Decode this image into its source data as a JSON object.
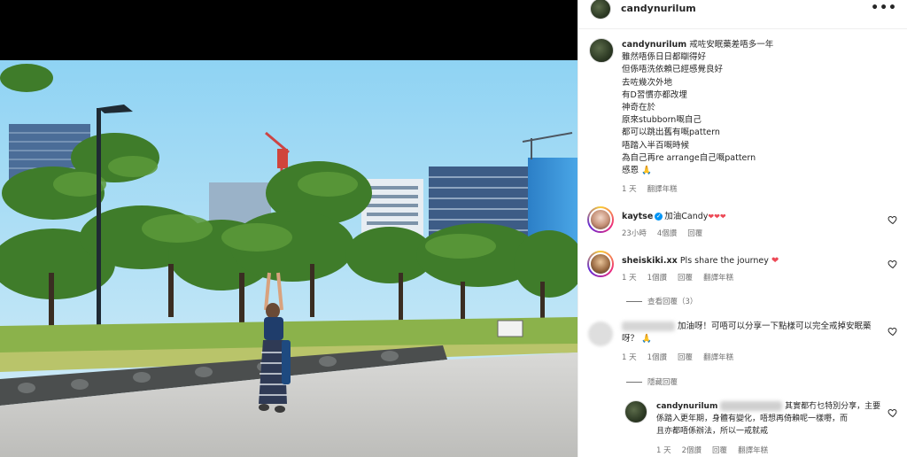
{
  "post": {
    "username": "candynurilum",
    "more_icon": "more-horizontal-icon",
    "caption_lines": [
      "戒咗安眠藥差唔多一年",
      "雖然唔係日日都瞓得好",
      "但係唔洗依賴已經感覺良好",
      "去咗幾次外地",
      "有D習慣亦都改埋",
      "神奇在於",
      "原來stubborn嘅自己",
      "都可以跳出舊有嘅pattern",
      "唔踏入半百嘅時候",
      "為自己再re arrange自己嘅pattern",
      "感恩"
    ],
    "caption_emoji": "🙏",
    "caption_time": "1 天",
    "caption_translate": "翻譯年糕"
  },
  "comments": [
    {
      "username": "kaytse",
      "text": "加油Candy",
      "tail": "❤❤❤",
      "time": "23小時",
      "likes": "4個讚",
      "reply": "回覆"
    },
    {
      "username": "sheiskiki.xx",
      "text": "Pls share the journey",
      "emoji": "❤",
      "time": "1 天",
      "likes": "1個讚",
      "reply": "回覆",
      "translate": "翻譯年糕",
      "view_replies": "查看回覆（3）"
    },
    {
      "text_line1": "加油呀！可唔可以分享一下點樣可以完全戒掉安眠藥",
      "text_line2": "呀？",
      "emoji": "🙏",
      "time": "1 天",
      "likes": "1個讚",
      "reply": "回覆",
      "translate": "翻譯年糕",
      "hide_replies": "隱藏回覆"
    }
  ],
  "reply": {
    "username": "candynurilum",
    "line1_tail": "其實都冇乜特別分享，主要",
    "line2": "係踏入更年期，身體有變化，唔想再倚賴呢一樣嘢，而",
    "line3": "且亦都唔係辦法，所以一戒就戒",
    "time": "1 天",
    "likes": "2個讚",
    "reply": "回覆",
    "translate": "翻譯年糕"
  },
  "colors": {
    "accent": "#0095f6",
    "heart_red": "#ed4956",
    "meta_gray": "#737373"
  }
}
